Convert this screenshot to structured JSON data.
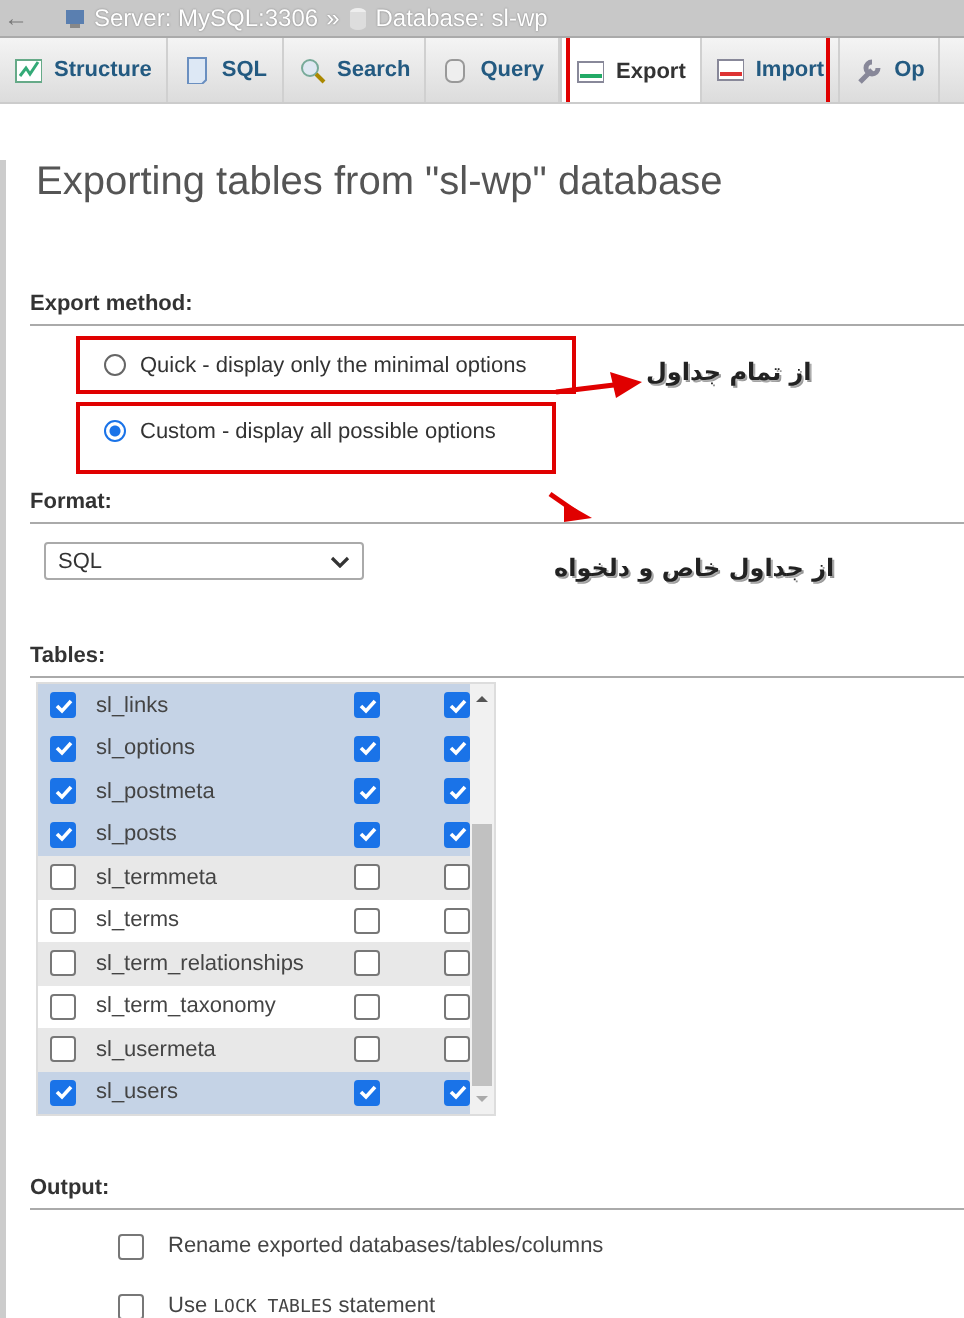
{
  "breadcrumb": {
    "back": "←",
    "server": "Server: MySQL:3306",
    "separator": "»",
    "database": "Database: sl-wp"
  },
  "tabs": [
    {
      "label": "Structure",
      "selected": false
    },
    {
      "label": "SQL",
      "selected": false
    },
    {
      "label": "Search",
      "selected": false
    },
    {
      "label": "Query",
      "selected": false
    },
    {
      "label": "Export",
      "selected": true
    },
    {
      "label": "Import",
      "selected": false
    },
    {
      "label": "Op",
      "selected": false
    }
  ],
  "title": "Exporting tables from \"sl-wp\" database",
  "export_method": {
    "heading": "Export method:",
    "options": [
      {
        "label": "Quick - display only the minimal options",
        "selected": false
      },
      {
        "label": "Custom - display all possible options",
        "selected": true
      }
    ]
  },
  "format": {
    "heading": "Format:",
    "value": "SQL"
  },
  "tables": {
    "heading": "Tables:",
    "rows": [
      {
        "name": "sl_links",
        "checked": true,
        "structure": true,
        "data": true
      },
      {
        "name": "sl_options",
        "checked": true,
        "structure": true,
        "data": true
      },
      {
        "name": "sl_postmeta",
        "checked": true,
        "structure": true,
        "data": true
      },
      {
        "name": "sl_posts",
        "checked": true,
        "structure": true,
        "data": true
      },
      {
        "name": "sl_termmeta",
        "checked": false,
        "structure": false,
        "data": false
      },
      {
        "name": "sl_terms",
        "checked": false,
        "structure": false,
        "data": false
      },
      {
        "name": "sl_term_relationships",
        "checked": false,
        "structure": false,
        "data": false
      },
      {
        "name": "sl_term_taxonomy",
        "checked": false,
        "structure": false,
        "data": false
      },
      {
        "name": "sl_usermeta",
        "checked": false,
        "structure": false,
        "data": false
      },
      {
        "name": "sl_users",
        "checked": true,
        "structure": true,
        "data": true
      }
    ]
  },
  "output": {
    "heading": "Output:",
    "options": [
      {
        "label": "Rename exported databases/tables/columns",
        "checked": false
      },
      {
        "label": "Use **LOCK TABLES** statement",
        "checked": false
      }
    ]
  },
  "annotations": [
    {
      "text": "از تمام جداول"
    },
    {
      "text": "از جداول خاص و دلخواه"
    }
  ]
}
